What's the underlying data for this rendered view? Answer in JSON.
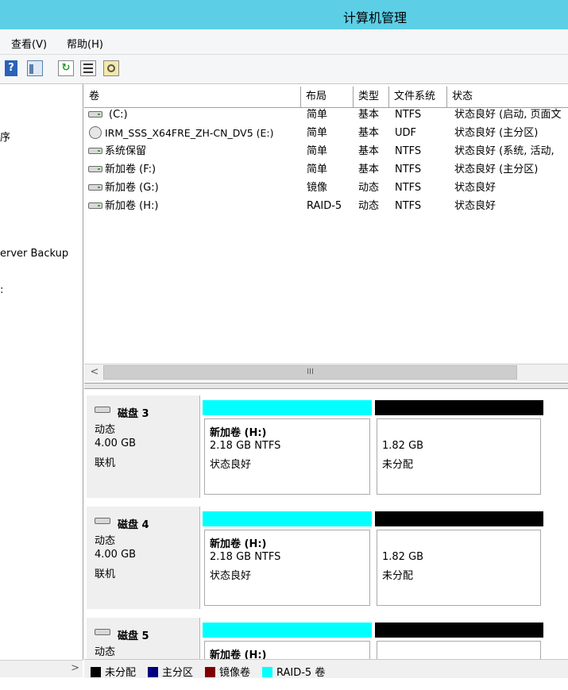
{
  "window": {
    "title": "计算机管理"
  },
  "menu": [
    {
      "label": "查看(V)"
    },
    {
      "label": "帮助(H)"
    }
  ],
  "toolbar": {
    "buttons": [
      {
        "icon": "help-icon"
      },
      {
        "icon": "show-hide-pane-icon"
      },
      {
        "icon": "refresh-icon"
      },
      {
        "icon": "properties-icon"
      },
      {
        "icon": "settings-icon"
      }
    ]
  },
  "left_pane": {
    "items": [
      {
        "label": "序"
      },
      {
        "label": "erver Backup"
      },
      {
        "label": ":"
      }
    ]
  },
  "volume_list": {
    "columns": [
      "卷",
      "布局",
      "类型",
      "文件系统",
      "状态"
    ],
    "rows": [
      {
        "name": "(C:)",
        "layout": "简单",
        "type": "基本",
        "fs": "NTFS",
        "status": "状态良好 (启动, 页面文",
        "icon": "drive-icon"
      },
      {
        "name": "IRM_SSS_X64FRE_ZH-CN_DV5 (E:)",
        "layout": "简单",
        "type": "基本",
        "fs": "UDF",
        "status": "状态良好 (主分区)",
        "icon": "cd-drive-icon"
      },
      {
        "name": "系统保留",
        "layout": "简单",
        "type": "基本",
        "fs": "NTFS",
        "status": "状态良好 (系统, 活动,",
        "icon": "drive-icon"
      },
      {
        "name": "新加卷 (F:)",
        "layout": "简单",
        "type": "基本",
        "fs": "NTFS",
        "status": "状态良好 (主分区)",
        "icon": "drive-icon"
      },
      {
        "name": "新加卷 (G:)",
        "layout": "镜像",
        "type": "动态",
        "fs": "NTFS",
        "status": "状态良好",
        "icon": "drive-icon"
      },
      {
        "name": "新加卷 (H:)",
        "layout": "RAID-5",
        "type": "动态",
        "fs": "NTFS",
        "status": "状态良好",
        "icon": "drive-icon"
      }
    ],
    "hscroll_left": "<",
    "hscroll_thumb": "III"
  },
  "disks": [
    {
      "name": "磁盘 3",
      "kind": "动态",
      "size": "4.00 GB",
      "state": "联机",
      "parts": [
        {
          "title": "新加卷 (H:)",
          "detail": "2.18 GB NTFS",
          "status": "状态良好",
          "color": "#00ffff"
        },
        {
          "title": "",
          "detail": "1.82 GB",
          "status": "未分配",
          "color": "#000000"
        }
      ]
    },
    {
      "name": "磁盘 4",
      "kind": "动态",
      "size": "4.00 GB",
      "state": "联机",
      "parts": [
        {
          "title": "新加卷 (H:)",
          "detail": "2.18 GB NTFS",
          "status": "状态良好",
          "color": "#00ffff"
        },
        {
          "title": "",
          "detail": "1.82 GB",
          "status": "未分配",
          "color": "#000000"
        }
      ]
    },
    {
      "name": "磁盘 5",
      "kind": "动态",
      "size": "",
      "state": "",
      "parts": [
        {
          "title": "新加卷 (H:)",
          "detail": "",
          "status": "",
          "color": "#00ffff"
        },
        {
          "title": "",
          "detail": "",
          "status": "",
          "color": "#000000"
        }
      ]
    }
  ],
  "legend": [
    {
      "label": "未分配",
      "color": "#000000"
    },
    {
      "label": "主分区",
      "color": "#000080"
    },
    {
      "label": "镜像卷",
      "color": "#800000"
    },
    {
      "label": "RAID-5 卷",
      "color": "#00ffff"
    }
  ],
  "left_scroll_arrow": ">"
}
